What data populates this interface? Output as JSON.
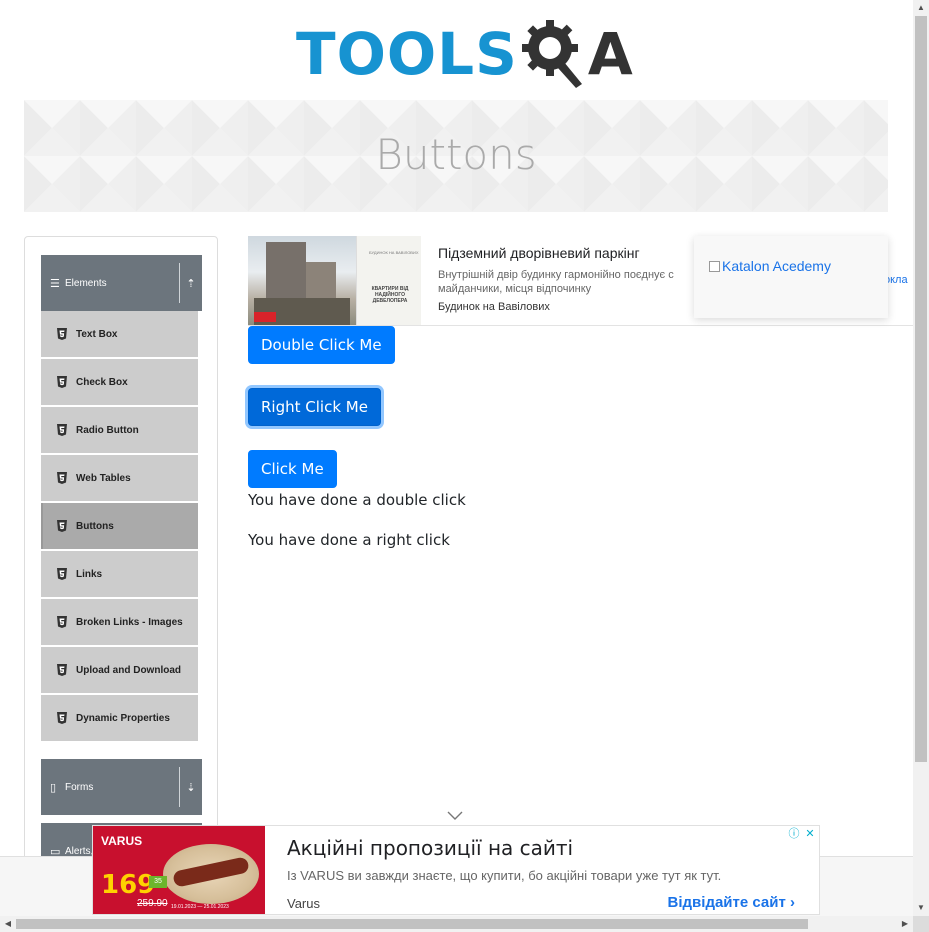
{
  "logo": {
    "text_main": "TOOLS",
    "text_end": "A"
  },
  "banner": {
    "title": "Buttons"
  },
  "sidebar": {
    "elements_group": {
      "label": "Elements"
    },
    "items": [
      {
        "label": "Text Box"
      },
      {
        "label": "Check Box"
      },
      {
        "label": "Radio Button"
      },
      {
        "label": "Web Tables"
      },
      {
        "label": "Buttons",
        "active": true
      },
      {
        "label": "Links"
      },
      {
        "label": "Broken Links - Images"
      },
      {
        "label": "Upload and Download"
      },
      {
        "label": "Dynamic Properties"
      }
    ],
    "forms_group": {
      "label": "Forms"
    },
    "alerts_group": {
      "label": "Alerts,"
    }
  },
  "ad_top": {
    "title": "Підземний дворівневий паркінг",
    "description": "Внутрішній двір будинку гармонійно поєднує с майданчики, місця відпочинку",
    "advertiser": "Будинок на Вавілових",
    "more": "окла",
    "image_sub": "БУДИНОК НА ВАВІЛОВИХ",
    "image_text": "КВАРТИРИ ВІД НАДІЙНОГО ДЕВЕЛОПЕРА"
  },
  "katalon": {
    "alt_text": "Katalon Acedemy"
  },
  "buttons": {
    "double_click": "Double Click Me",
    "right_click": "Right Click Me",
    "click": "Click Me"
  },
  "messages": {
    "double": "You have done a double click",
    "right": "You have done a right click"
  },
  "ad_bottom": {
    "brand": "VARUS",
    "price": "169",
    "old_price": "259.90",
    "dates": "19.01.2023 — 25.01.2023",
    "tag": "35",
    "title": "Акційні пропозиції на сайті",
    "description": "Із VARUS ви завжди знаєте, що купити, бо акційні товари уже тут як тут.",
    "advertiser": "Varus",
    "cta": "Відвідайте сайт",
    "info_icon": "ⓘ",
    "close_icon": "✕"
  },
  "colors": {
    "primary": "#007bff",
    "logo_blue": "#1793d1",
    "logo_dark": "#333333",
    "sidebar_header": "#6c757d",
    "menu_item": "#cccccc",
    "menu_item_active": "#aaaaaa"
  }
}
